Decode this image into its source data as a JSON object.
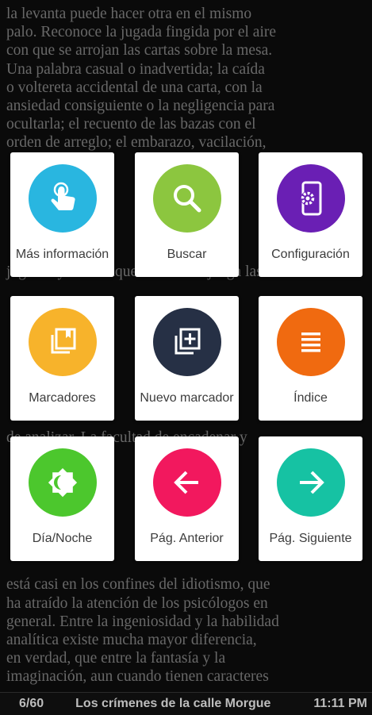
{
  "book_text": [
    "la levanta puede hacer otra en el mismo",
    "palo. Reconoce la jugada fingida por el aire",
    "con que se arrojan las cartas sobre la mesa.",
    "Una palabra casual o inadvertida; la caída",
    "o voltereta accidental de una carta, con la",
    "ansiedad consiguiente o la negligencia para",
    "ocultarla; el recuento de las bazas con el",
    "orden de arreglo; el embarazo, vacilación,",
    "",
    "",
    "",
    "",
    "",
    "",
    "jugador y desde aquel momento juega las",
    "",
    "",
    "",
    "",
    "",
    "",
    "",
    "",
    "de analizar. La facultad de encadenar y",
    "",
    "",
    "",
    "",
    "",
    "",
    "",
    "está casi en los confines del idiotismo, que",
    "ha atraído la atención de los psicólogos en",
    "general. Entre la ingeniosidad y la habilidad",
    "analítica existe mucha mayor diferencia,",
    "en verdad, que entre la fantasía y la",
    "imaginación, aun cuando tienen caracteres"
  ],
  "menu": {
    "more_info": {
      "label": "Más información",
      "icon": "touch-icon",
      "color": "#29b6e0"
    },
    "search": {
      "label": "Buscar",
      "icon": "search-icon",
      "color": "#8cc63f"
    },
    "settings": {
      "label": "Configuración",
      "icon": "settings-icon",
      "color": "#6a1fb4"
    },
    "bookmarks": {
      "label": "Marcadores",
      "icon": "bookmarks-icon",
      "color": "#f7b32b"
    },
    "new_bookmark": {
      "label": "Nuevo marcador",
      "icon": "add-bookmark-icon",
      "color": "#263045"
    },
    "index": {
      "label": "Índice",
      "icon": "list-icon",
      "color": "#f06a10"
    },
    "day_night": {
      "label": "Día/Noche",
      "icon": "day-night-icon",
      "color": "#4cc72d"
    },
    "prev_page": {
      "label": "Pág. Anterior",
      "icon": "arrow-left-icon",
      "color": "#f2185e"
    },
    "next_page": {
      "label": "Pág. Siguiente",
      "icon": "arrow-right-icon",
      "color": "#16c2a3"
    }
  },
  "status": {
    "page": "6/60",
    "title": "Los crímenes de la calle Morgue",
    "time": "11:11 PM"
  }
}
